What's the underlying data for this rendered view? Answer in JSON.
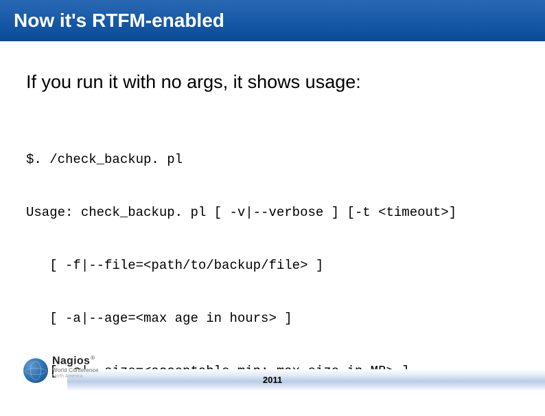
{
  "title": "Now it's RTFM-enabled",
  "subtitle": "If you run it with no args, it shows usage:",
  "code_lines": [
    "$. /check_backup. pl",
    "Usage: check_backup. pl [ -v|--verbose ] [-t <timeout>]",
    "   [ -f|--file=<path/to/backup/file> ]",
    "   [ -a|--age=<max age in hours> ]",
    "   [ -s|--size=<acceptable min: max size in MB> ]"
  ],
  "footer": {
    "year": "2011",
    "logo_name": "Nagios",
    "logo_reg": "®",
    "logo_sub": "World Conference",
    "logo_sub2": "North America"
  }
}
